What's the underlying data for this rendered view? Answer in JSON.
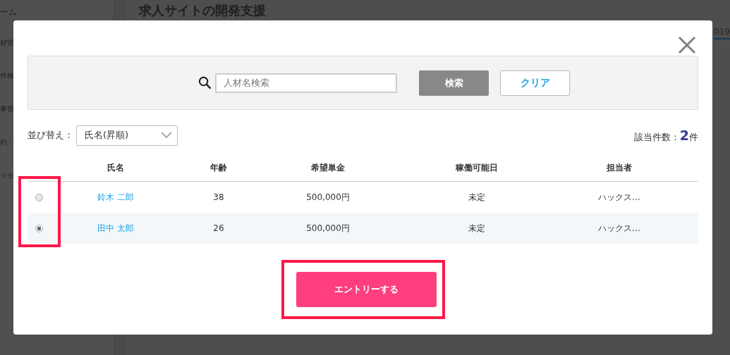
{
  "background": {
    "sidebar_items": [
      "ーム",
      "材管",
      "件検",
      "事管",
      "約・",
      "ッセ"
    ],
    "page_title": "求人サイトの開発支援",
    "date_fragment": "019"
  },
  "modal": {
    "search": {
      "placeholder": "人材名検索",
      "search_button": "検索",
      "clear_button": "クリア"
    },
    "sort": {
      "label": "並び替え：",
      "value": "氏名(昇順)"
    },
    "result_count": {
      "label": "該当件数：",
      "count": "2",
      "unit": "件"
    },
    "table": {
      "selection_highlighted": true,
      "columns": [
        "氏名",
        "年齢",
        "希望単金",
        "稼働可能日",
        "担当者"
      ],
      "rows": [
        {
          "selected": false,
          "cells": [
            "鈴木 二郎",
            "38",
            "500,000円",
            "未定",
            "ハックス…"
          ]
        },
        {
          "selected": true,
          "cells": [
            "田中 太郎",
            "26",
            "500,000円",
            "未定",
            "ハックス…"
          ]
        }
      ]
    },
    "entry_button": {
      "label": "エントリーする",
      "highlighted": true
    }
  }
}
